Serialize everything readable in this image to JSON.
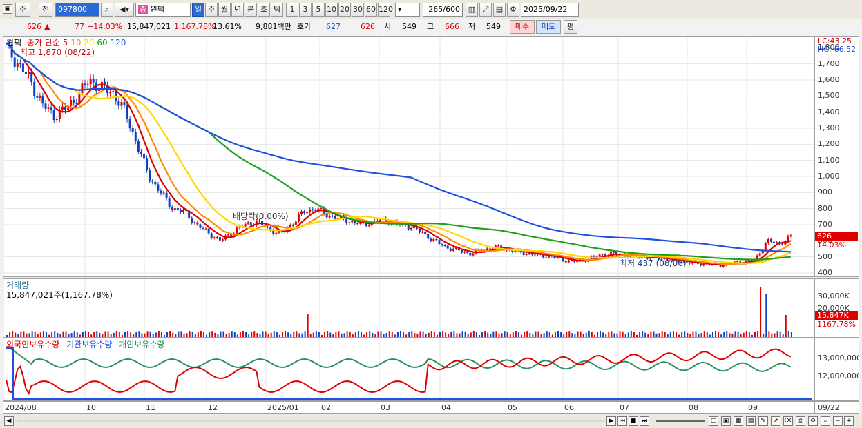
{
  "toolbar": {
    "period_type": "주",
    "prev_label": "전",
    "code": "097800",
    "stock_name": "윈팩",
    "timeframes": [
      "일",
      "주",
      "월",
      "년",
      "분",
      "초",
      "틱"
    ],
    "intervals": [
      "1",
      "3",
      "5",
      "10",
      "20",
      "30",
      "60",
      "120"
    ],
    "count": "265",
    "count_total": "/600",
    "date": "2025/09/22"
  },
  "quote": {
    "price": "626",
    "arrow": "▲",
    "change": "77",
    "change_pct": "+14.03%",
    "volume": "15,847,021",
    "volume_pct": "1,167.78%",
    "turnover": "13.61%",
    "amount": "9,881백만",
    "hoga_label": "호가",
    "ask": "627",
    "bid": "626",
    "open_label": "시",
    "open": "549",
    "high_label": "고",
    "high": "666",
    "low_label": "저",
    "low": "549",
    "buy": "매수",
    "sell": "매도",
    "eval": "평"
  },
  "price_panel": {
    "name": "윈팩",
    "ma_label": "종가 단순",
    "ma_periods": [
      "5",
      "10",
      "20",
      "60",
      "120"
    ],
    "ma_colors": [
      "#e00000",
      "#ff8c00",
      "#ffd700",
      "#1aa01a",
      "#2050e0"
    ],
    "high_note": "최고 1,870 (08/22)",
    "low_note": "최저 437 (08/06)",
    "dividend_note": "배당락(0.00%)",
    "lc": "LC:43.25",
    "hc": "HC:-66.52",
    "price_tag": "626",
    "pct_tag": "14.03%",
    "y_ticks": [
      "1,800",
      "1,700",
      "1,600",
      "1,500",
      "1,400",
      "1,300",
      "1,200",
      "1,100",
      "1,000",
      "900",
      "800",
      "700",
      "600",
      "500",
      "400"
    ]
  },
  "volume_panel": {
    "title": "거래량",
    "summary": "15,847,021주(1,167.78%)",
    "y_ticks": [
      "30,000K",
      "20,000K"
    ],
    "tag_vol": "15,847K",
    "tag_pct": "1167.78%"
  },
  "holding_panel": {
    "series": [
      "외국인보유수량",
      "기관보유수량",
      "개인보유수량"
    ],
    "y_ticks": [
      "13,000,000",
      "12,000,000"
    ]
  },
  "x_axis": [
    "2024/08",
    "10",
    "11",
    "12",
    "2025/01",
    "02",
    "03",
    "04",
    "05",
    "06",
    "07",
    "08",
    "09"
  ],
  "x_axis_right": "09/22",
  "chart_data": {
    "type": "candlestick",
    "ylim": [
      380,
      1900
    ],
    "price_path": [
      1800,
      1700,
      1600,
      1450,
      1380,
      1420,
      1500,
      1600,
      1550,
      1520,
      1400,
      1200,
      1000,
      900,
      800,
      780,
      700,
      650,
      600,
      650,
      700,
      720,
      680,
      640,
      700,
      780,
      800,
      760,
      740,
      720,
      700,
      720,
      730,
      700,
      690,
      650,
      600,
      560,
      540,
      520,
      540,
      560,
      550,
      530,
      520,
      510,
      500,
      480,
      470,
      490,
      510,
      520,
      510,
      500,
      500,
      490,
      480,
      470,
      460,
      455,
      450,
      460,
      470,
      480,
      600,
      580,
      626
    ]
  }
}
